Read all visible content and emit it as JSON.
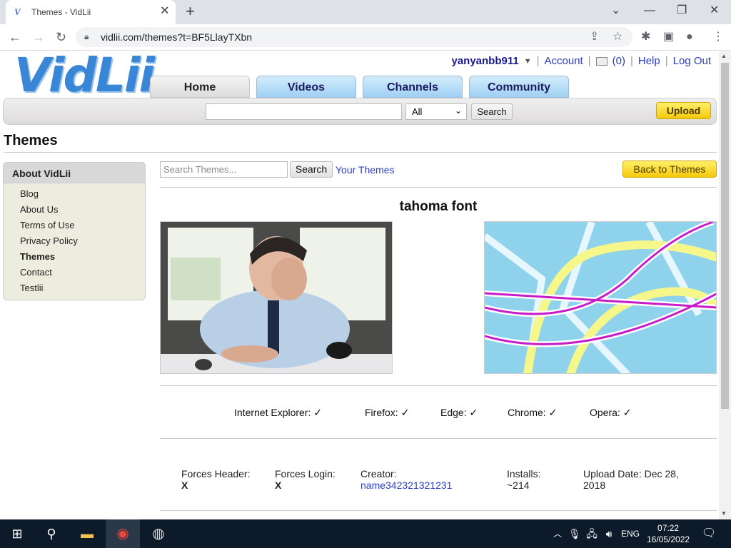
{
  "browser": {
    "tab_title": "Themes - VidLii",
    "tab_favicon": "V",
    "url": "vidlii.com/themes?t=BF5LlayTXbn"
  },
  "site": {
    "logo_text": "VidLii",
    "user": {
      "username": "yanyanbb911",
      "account_label": "Account",
      "inbox_count": "(0)",
      "help_label": "Help",
      "logout_label": "Log Out"
    },
    "nav_tabs": [
      {
        "label": "Home"
      },
      {
        "label": "Videos"
      },
      {
        "label": "Channels"
      },
      {
        "label": "Community"
      }
    ],
    "search": {
      "value": "",
      "select_value": "All",
      "button_label": "Search"
    },
    "upload_label": "Upload"
  },
  "page": {
    "title": "Themes",
    "sidebar": {
      "heading": "About VidLii",
      "items": [
        {
          "label": "Blog"
        },
        {
          "label": "About Us"
        },
        {
          "label": "Terms of Use"
        },
        {
          "label": "Privacy Policy"
        },
        {
          "label": "Themes"
        },
        {
          "label": "Contact"
        },
        {
          "label": "Testlii"
        }
      ]
    },
    "theme_search": {
      "placeholder": "Search Themes...",
      "button_label": "Search",
      "your_themes_label": "Your Themes",
      "back_label": "Back to Themes"
    },
    "theme": {
      "name": "tahoma font",
      "compatibility": [
        {
          "browser": "Internet Explorer:",
          "mark": "✓"
        },
        {
          "browser": "Firefox:",
          "mark": "✓"
        },
        {
          "browser": "Edge:",
          "mark": "✓"
        },
        {
          "browser": "Chrome:",
          "mark": "✓"
        },
        {
          "browser": "Opera:",
          "mark": "✓"
        }
      ],
      "forces_header_label": "Forces Header:",
      "forces_header_value": "X",
      "forces_login_label": "Forces Login:",
      "forces_login_value": "X",
      "creator_label": "Creator:",
      "creator_name": "name342321321231",
      "installs_label": "Installs:",
      "installs_value": "~214",
      "upload_date_label": "Upload Date: Dec 28,",
      "upload_date_value": "2018"
    }
  },
  "taskbar": {
    "language": "ENG",
    "time": "07:22",
    "date": "16/05/2022"
  }
}
